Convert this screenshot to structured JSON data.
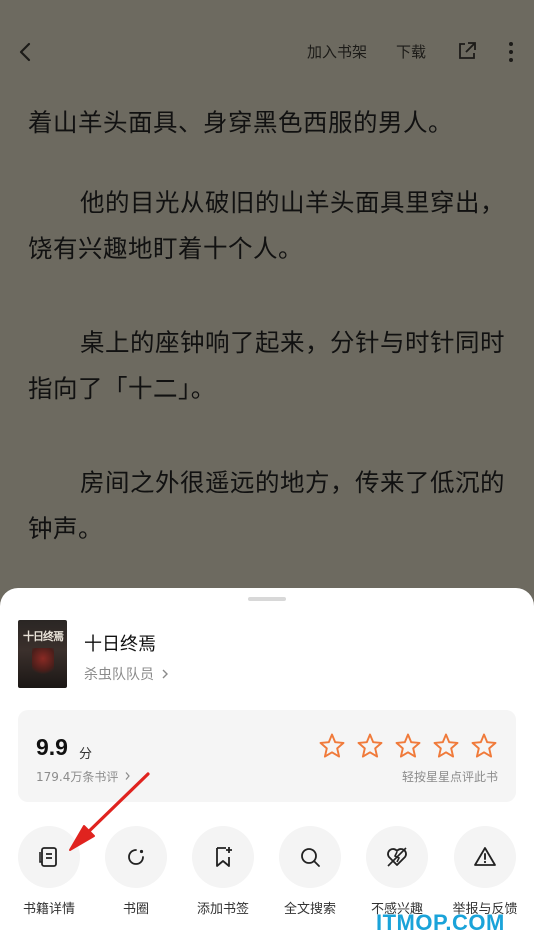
{
  "topbar": {
    "back_icon": "back-chevron-icon",
    "add_to_shelf": "加入书架",
    "download": "下载",
    "share_icon": "share-icon",
    "more_icon": "more-vertical-icon"
  },
  "reader": {
    "paragraphs": [
      "着山羊头面具、身穿黑色西服的男人。",
      "他的目光从破旧的山羊头面具里穿出，饶有兴趣地盯着十个人。",
      "桌上的座钟响了起来，分针与时针同时指向了「十二」。",
      "房间之外很遥远的地方，传来了低沉的钟声。"
    ]
  },
  "sheet": {
    "cover_text": "十日终焉",
    "book_title": "十日终焉",
    "author": "杀虫队队员",
    "rating": {
      "score": "9.9",
      "unit": "分",
      "review_count": "179.4万条书评",
      "stars_total": 5,
      "star_color": "#f07a3a",
      "hint": "轻按星星点评此书"
    },
    "actions": [
      {
        "label": "书籍详情",
        "icon": "book-details-icon"
      },
      {
        "label": "书圈",
        "icon": "circle-refresh-icon"
      },
      {
        "label": "添加书签",
        "icon": "bookmark-add-icon"
      },
      {
        "label": "全文搜索",
        "icon": "search-icon"
      },
      {
        "label": "不感兴趣",
        "icon": "broken-heart-icon"
      },
      {
        "label": "举报与反馈",
        "icon": "warning-icon"
      }
    ]
  },
  "annotation": {
    "arrow_color": "#e0231f"
  },
  "watermark": "ITMOP.COM"
}
